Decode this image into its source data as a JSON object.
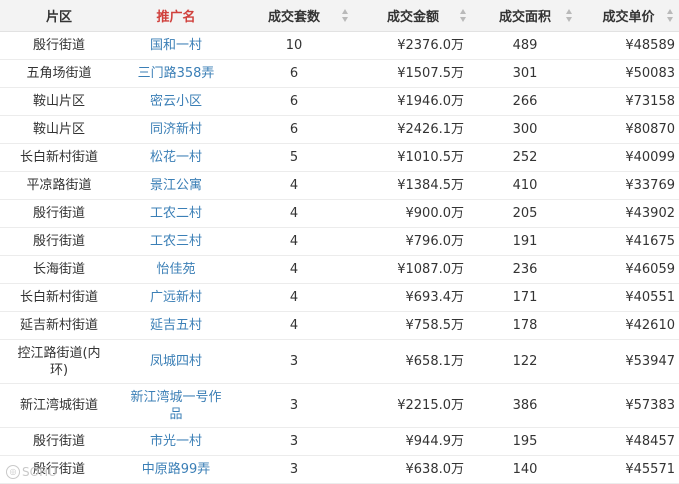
{
  "headers": [
    "片区",
    "推广名",
    "成交套数",
    "成交金额",
    "成交面积",
    "成交单价"
  ],
  "active_header_color": "#d0403c",
  "link_color": "#3b7fb6",
  "rows": [
    {
      "area": "殷行街道",
      "community": "国和一村",
      "count": "10",
      "amount": "¥2376.0万",
      "size": "489",
      "unit_price": "¥48589"
    },
    {
      "area": "五角场街道",
      "community": "三门路358弄",
      "count": "6",
      "amount": "¥1507.5万",
      "size": "301",
      "unit_price": "¥50083"
    },
    {
      "area": "鞍山片区",
      "community": "密云小区",
      "count": "6",
      "amount": "¥1946.0万",
      "size": "266",
      "unit_price": "¥73158"
    },
    {
      "area": "鞍山片区",
      "community": "同济新村",
      "count": "6",
      "amount": "¥2426.1万",
      "size": "300",
      "unit_price": "¥80870"
    },
    {
      "area": "长白新村街道",
      "community": "松花一村",
      "count": "5",
      "amount": "¥1010.5万",
      "size": "252",
      "unit_price": "¥40099"
    },
    {
      "area": "平凉路街道",
      "community": "景江公寓",
      "count": "4",
      "amount": "¥1384.5万",
      "size": "410",
      "unit_price": "¥33769"
    },
    {
      "area": "殷行街道",
      "community": "工农二村",
      "count": "4",
      "amount": "¥900.0万",
      "size": "205",
      "unit_price": "¥43902"
    },
    {
      "area": "殷行街道",
      "community": "工农三村",
      "count": "4",
      "amount": "¥796.0万",
      "size": "191",
      "unit_price": "¥41675"
    },
    {
      "area": "长海街道",
      "community": "怡佳苑",
      "count": "4",
      "amount": "¥1087.0万",
      "size": "236",
      "unit_price": "¥46059"
    },
    {
      "area": "长白新村街道",
      "community": "广远新村",
      "count": "4",
      "amount": "¥693.4万",
      "size": "171",
      "unit_price": "¥40551"
    },
    {
      "area": "延吉新村街道",
      "community": "延吉五村",
      "count": "4",
      "amount": "¥758.5万",
      "size": "178",
      "unit_price": "¥42610"
    },
    {
      "area": "控江路街道(内环)",
      "community": "凤城四村",
      "count": "3",
      "amount": "¥658.1万",
      "size": "122",
      "unit_price": "¥53947"
    },
    {
      "area": "新江湾城街道",
      "community": "新江湾城一号作品",
      "count": "3",
      "amount": "¥2215.0万",
      "size": "386",
      "unit_price": "¥57383"
    },
    {
      "area": "殷行街道",
      "community": "市光一村",
      "count": "3",
      "amount": "¥944.9万",
      "size": "195",
      "unit_price": "¥48457"
    },
    {
      "area": "殷行街道",
      "community": "中原路99弄",
      "count": "3",
      "amount": "¥638.0万",
      "size": "140",
      "unit_price": "¥45571"
    }
  ],
  "watermark": {
    "icon": "camera-icon",
    "text": "SOHU"
  }
}
